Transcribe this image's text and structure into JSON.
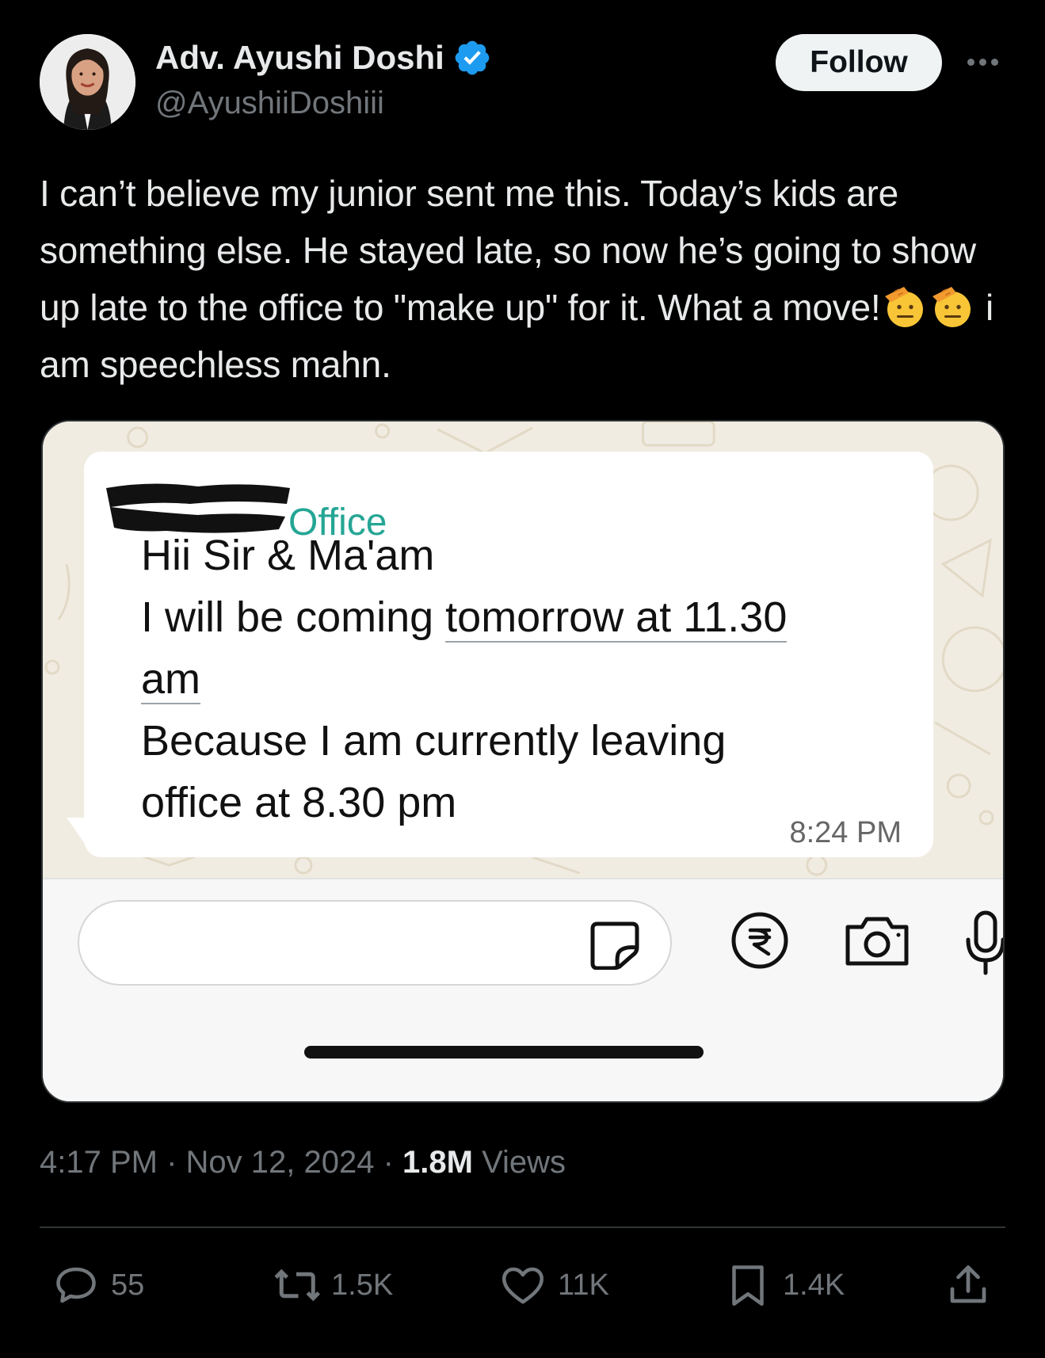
{
  "author": {
    "display_name": "Adv. Ayushi Doshi",
    "handle": "@AyushiiDoshiii",
    "verified": true
  },
  "follow_label": "Follow",
  "tweet": {
    "text_before_emoji": "I can’t believe my junior sent me this. Today’s kids are something else. He stayed late, so now he’s going to show up late to the office to \"make up\" for it. What a move!",
    "emojis": [
      "saluting-face",
      "saluting-face"
    ],
    "text_after_emoji": " i am speechless mahn."
  },
  "screenshot": {
    "sender_suffix": "Office",
    "line1": "Hii Sir & Ma'am",
    "line2_a": "I will be coming ",
    "line2_b": "tomorrow at 11.30",
    "line3": "am",
    "line4": "Because I am currently leaving",
    "line5": "office at 8.30 pm",
    "time": "8:24 PM"
  },
  "meta": {
    "time": "4:17 PM",
    "date": "Nov 12, 2024",
    "views_count": "1.8M",
    "views_label": "Views"
  },
  "actions": {
    "replies": "55",
    "reposts": "1.5K",
    "likes": "11K",
    "bookmarks": "1.4K"
  },
  "colors": {
    "background": "#000000",
    "verified": "#1d9bf0",
    "sender_name": "#25a695",
    "muted_text": "#71767b"
  }
}
